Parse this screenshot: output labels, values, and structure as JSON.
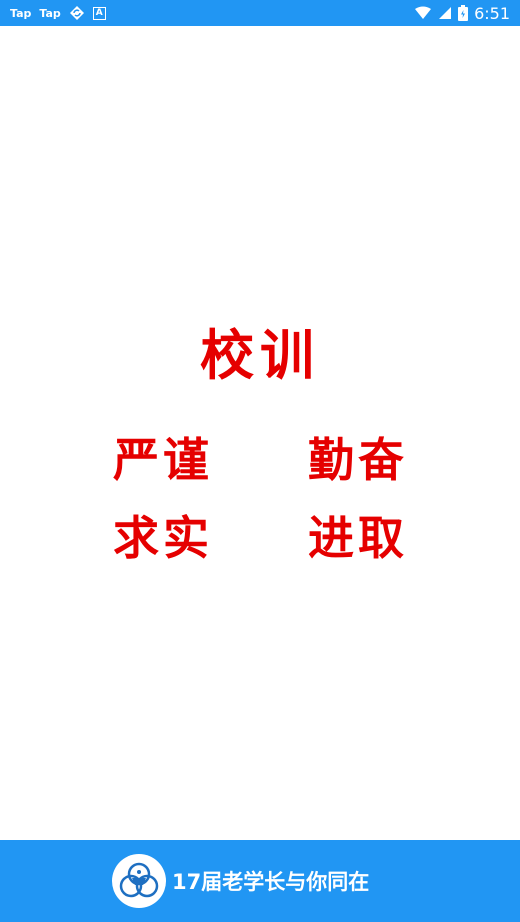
{
  "status_bar": {
    "left_items": [
      "Tap",
      "Tap"
    ],
    "a_badge": "A",
    "time": "6:51",
    "icons": [
      "tap-icon",
      "tap-icon",
      "sync-icon",
      "a-badge-icon",
      "wifi-icon",
      "signal-icon",
      "battery-icon"
    ]
  },
  "motto": {
    "title": "校训",
    "words": [
      "严谨",
      "勤奋",
      "求实",
      "进取"
    ],
    "color": "#e50000"
  },
  "footer": {
    "brand_text": "17届老学长与你同在",
    "bg_color": "#2196f3"
  }
}
